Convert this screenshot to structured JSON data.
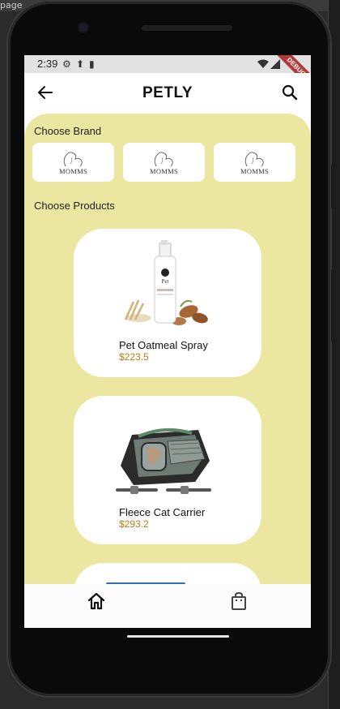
{
  "host": {
    "page_label": "page"
  },
  "status_bar": {
    "time": "2:39",
    "debug_label": "DEBUG"
  },
  "app_bar": {
    "title": "PETLY"
  },
  "brands": {
    "label": "Choose Brand",
    "items": [
      {
        "name": "MOMMS"
      },
      {
        "name": "MOMMS"
      },
      {
        "name": "MOMMS"
      }
    ]
  },
  "products": {
    "label": "Choose Products",
    "items": [
      {
        "name": "Pet Oatmeal Spray",
        "price": "$223.5"
      },
      {
        "name": "Fleece Cat Carrier",
        "price": "$293.2"
      }
    ]
  },
  "colors": {
    "content_bg": "#ebe6a0",
    "price": "#b57d16",
    "card_bg": "#ffffff"
  },
  "icons": {
    "back": "arrow-left",
    "search": "magnifier",
    "home": "home",
    "bag": "shopping-bag"
  }
}
